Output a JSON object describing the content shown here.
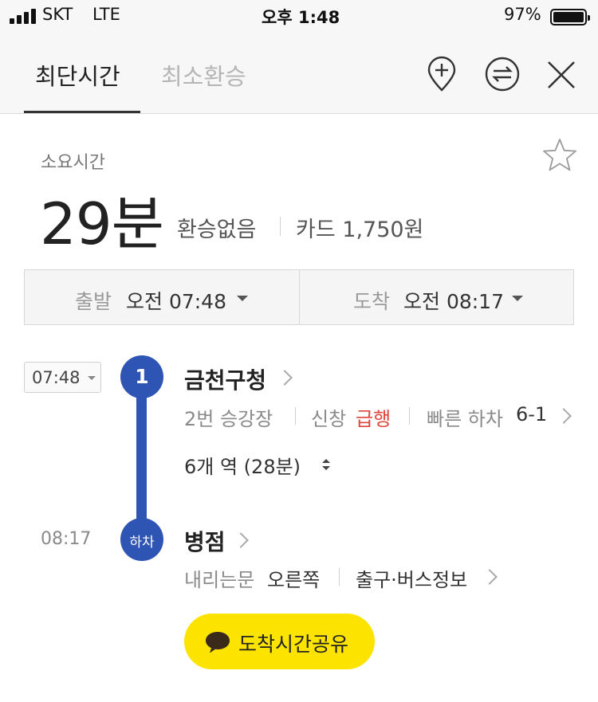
{
  "status_bar": {
    "carrier": "SKT",
    "network": "LTE",
    "time": "오후 1:48",
    "battery": "97%",
    "battery_level": 0.97
  },
  "header": {
    "tabs": [
      {
        "label": "최단시간",
        "active": true
      },
      {
        "label": "최소환승",
        "active": false
      }
    ],
    "icons": [
      "add-location-icon",
      "swap-icon",
      "close-icon"
    ]
  },
  "summary": {
    "duration_label": "소요시간",
    "duration_value": "29분",
    "transfer_info": "환승없음",
    "fare": "카드 1,750원",
    "favorite_icon": "star-outline-icon"
  },
  "time_selector": {
    "depart_label": "출발",
    "depart_value": "오전 07:48",
    "arrive_label": "도착",
    "arrive_value": "오전 08:17"
  },
  "route": {
    "line_color": "#2f55b4",
    "board": {
      "time": "07:48",
      "step": "1",
      "station": "금천구청",
      "platform": "2번 승강장",
      "direction": "신창",
      "express": "급행",
      "fast_exit_label": "빠른 하차",
      "fast_exit_value": "6-1"
    },
    "ride": {
      "stops_summary": "6개 역 (28분)"
    },
    "alight": {
      "time": "08:17",
      "marker": "하차",
      "station": "병점",
      "door_label": "내리는문",
      "door_value": "오른쪽",
      "exit_info": "출구·버스정보"
    }
  },
  "share": {
    "label": "도착시간공유",
    "color": "#fce400",
    "icon": "speech-bubble-icon"
  }
}
